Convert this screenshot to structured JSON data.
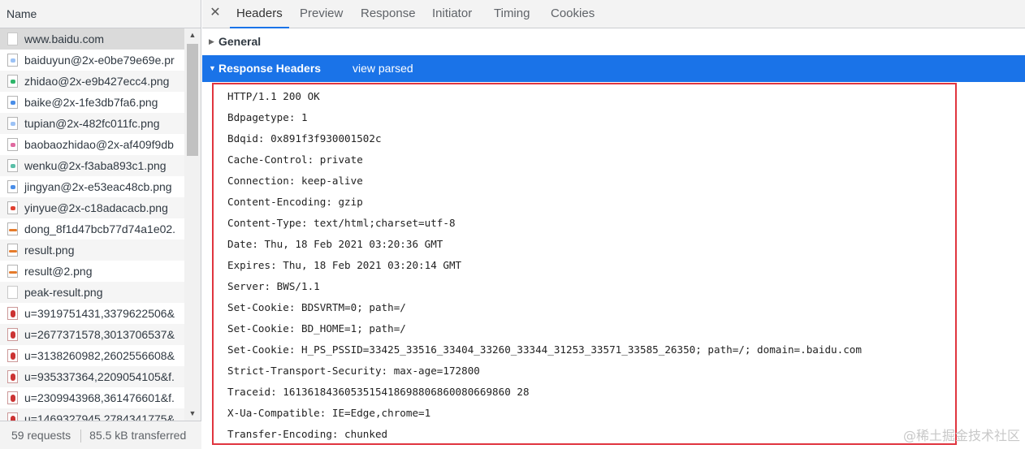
{
  "left_panel": {
    "column_header": "Name",
    "requests": [
      {
        "name": "www.baidu.com",
        "icon": "document-icon"
      },
      {
        "name": "baiduyun@2x-e0be79e69e.pr",
        "icon": "image-icon"
      },
      {
        "name": "zhidao@2x-e9b427ecc4.png",
        "icon": "image-icon"
      },
      {
        "name": "baike@2x-1fe3db7fa6.png",
        "icon": "image-icon"
      },
      {
        "name": "tupian@2x-482fc011fc.png",
        "icon": "image-icon"
      },
      {
        "name": "baobaozhidao@2x-af409f9db",
        "icon": "image-icon"
      },
      {
        "name": "wenku@2x-f3aba893c1.png",
        "icon": "image-icon"
      },
      {
        "name": "jingyan@2x-e53eac48cb.png",
        "icon": "image-icon"
      },
      {
        "name": "yinyue@2x-c18adacacb.png",
        "icon": "image-icon"
      },
      {
        "name": "dong_8f1d47bcb77d74a1e02.",
        "icon": "image-icon"
      },
      {
        "name": "result.png",
        "icon": "image-icon"
      },
      {
        "name": "result@2.png",
        "icon": "image-icon"
      },
      {
        "name": "peak-result.png",
        "icon": "document-icon"
      },
      {
        "name": "u=3919751431,3379622506&",
        "icon": "photo-icon"
      },
      {
        "name": "u=2677371578,3013706537&",
        "icon": "photo-icon"
      },
      {
        "name": "u=3138260982,2602556608&",
        "icon": "photo-icon"
      },
      {
        "name": "u=935337364,2209054105&f.",
        "icon": "photo-icon"
      },
      {
        "name": "u=2309943968,361476601&f.",
        "icon": "photo-icon"
      },
      {
        "name": "u=1469327945,2784341775&",
        "icon": "photo-icon"
      }
    ],
    "status": {
      "requests": "59 requests",
      "transferred": "85.5 kB transferred"
    }
  },
  "detail": {
    "tabs": [
      "Headers",
      "Preview",
      "Response",
      "Initiator",
      "Timing",
      "Cookies"
    ],
    "active_tab": "Headers",
    "general_label": "General",
    "response_headers_label": "Response Headers",
    "view_parsed_label": "view parsed",
    "response_headers": [
      "HTTP/1.1 200 OK",
      "Bdpagetype: 1",
      "Bdqid: 0x891f3f930001502c",
      "Cache-Control: private",
      "Connection: keep-alive",
      "Content-Encoding: gzip",
      "Content-Type: text/html;charset=utf-8",
      "Date: Thu, 18 Feb 2021 03:20:36 GMT",
      "Expires: Thu, 18 Feb 2021 03:20:14 GMT",
      "Server: BWS/1.1",
      "Set-Cookie: BDSVRTM=0; path=/",
      "Set-Cookie: BD_HOME=1; path=/",
      "Set-Cookie: H_PS_PSSID=33425_33516_33404_33260_33344_31253_33571_33585_26350; path=/; domain=.baidu.com",
      "Strict-Transport-Security: max-age=172800",
      "Traceid: 1613618436053515418698806860080669860 28",
      "X-Ua-Compatible: IE=Edge,chrome=1",
      "Transfer-Encoding: chunked"
    ]
  },
  "watermark": "@稀土掘金技术社区",
  "colors": {
    "accent": "#1a73e8",
    "highlight_border": "#e0353f",
    "selected_row": "#dadada"
  }
}
